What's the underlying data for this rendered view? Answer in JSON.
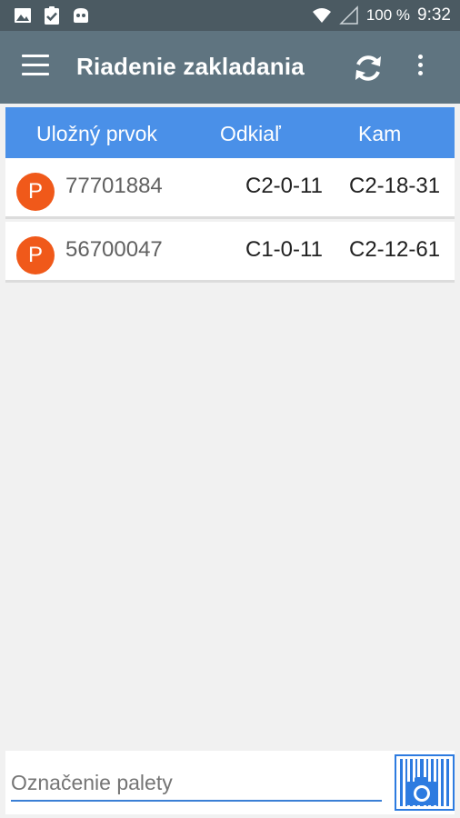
{
  "status_bar": {
    "battery": "100 %",
    "time": "9:32"
  },
  "app_bar": {
    "title": "Riadenie zakladania"
  },
  "table": {
    "headers": [
      "Uložný prvok",
      "Odkiaľ",
      "Kam"
    ],
    "rows": [
      {
        "badge": "P",
        "id": "77701884",
        "from": "C2-0-11",
        "to": "C2-18-31"
      },
      {
        "badge": "P",
        "id": "56700047",
        "from": "C1-0-11",
        "to": "C2-12-61"
      }
    ]
  },
  "pallet_input": {
    "placeholder": "Označenie palety",
    "value": ""
  },
  "colors": {
    "status_bar": "#4b5a62",
    "app_bar": "#5f7480",
    "table_header": "#4a90e8",
    "badge": "#f0591a",
    "accent": "#3a7fd5"
  }
}
